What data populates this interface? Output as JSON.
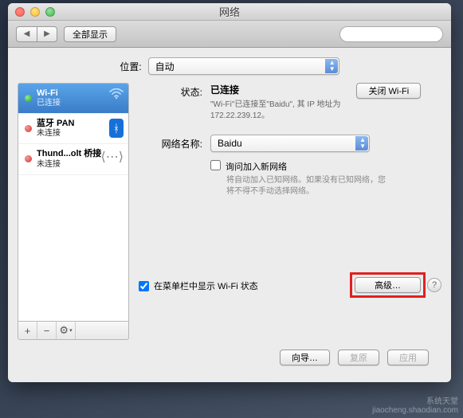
{
  "window": {
    "title": "网络"
  },
  "toolbar": {
    "show_all": "全部显示",
    "search_placeholder": ""
  },
  "location": {
    "label": "位置:",
    "value": "自动"
  },
  "services": [
    {
      "name": "Wi-Fi",
      "status": "已连接",
      "dot": "green",
      "icon": "wifi",
      "selected": true
    },
    {
      "name": "蓝牙 PAN",
      "status": "未连接",
      "dot": "red",
      "icon": "bluetooth",
      "selected": false
    },
    {
      "name": "Thund...olt 桥接",
      "status": "未连接",
      "dot": "red",
      "icon": "thunderbolt",
      "selected": false
    }
  ],
  "listbuttons": {
    "add": "+",
    "remove": "−",
    "gear": "⚙"
  },
  "detail": {
    "status_label": "状态:",
    "status_value": "已连接",
    "turn_off": "关闭 Wi-Fi",
    "status_desc_1": "\"Wi-Fi\"已连接至\"Baidu\", 其 IP 地址为",
    "status_desc_2": "172.22.239.12。",
    "network_label": "网络名称:",
    "network_value": "Baidu",
    "ask_join": "询问加入新网络",
    "ask_join_desc": "将自动加入已知网络。如果没有已知网络，您将不得不手动选择网络。",
    "show_menubar": "在菜单栏中显示 Wi-Fi 状态",
    "advanced": "高级…",
    "help": "?"
  },
  "footer": {
    "wizard": "向导…",
    "revert": "复原",
    "apply": "应用"
  },
  "watermark": {
    "line1": "系统天堂",
    "line2": "jiaocheng.shaodian.com"
  }
}
